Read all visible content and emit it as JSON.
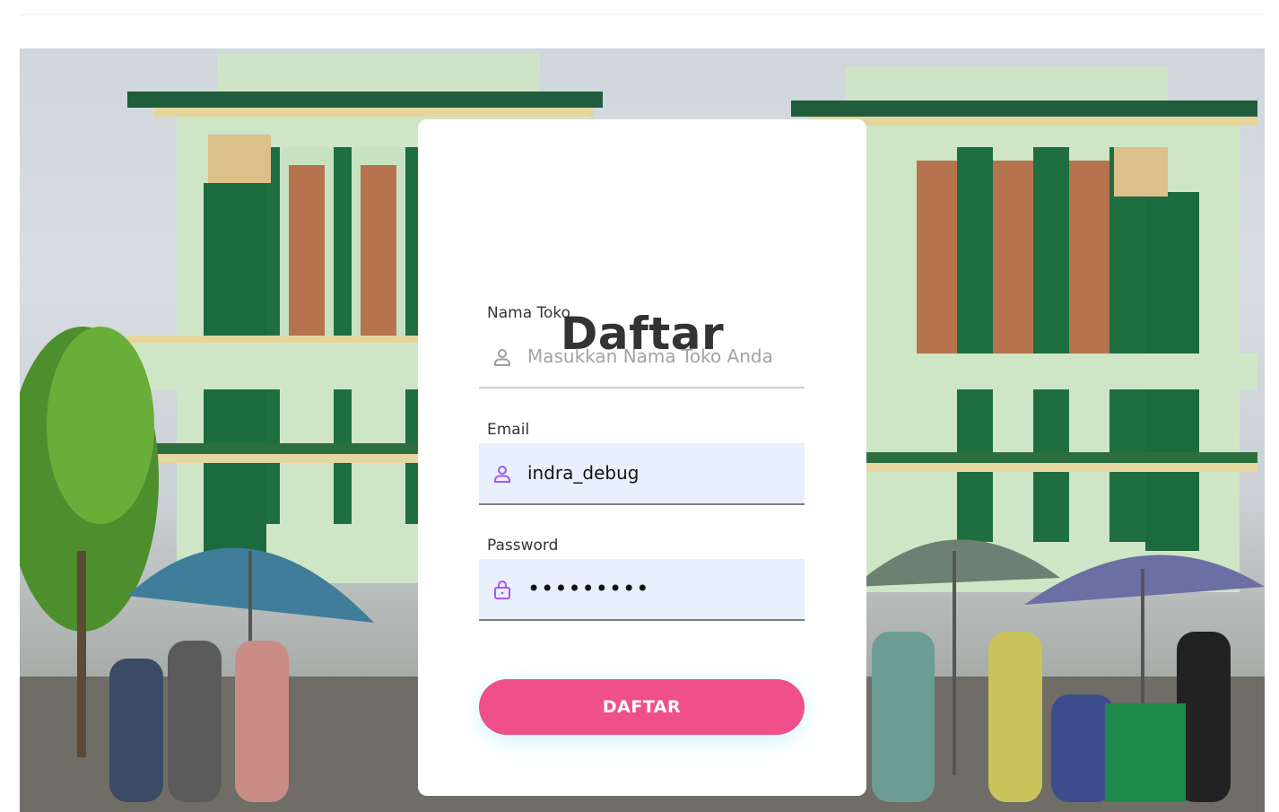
{
  "form": {
    "title": "Daftar",
    "store_name": {
      "label": "Nama Toko",
      "placeholder": "Masukkan Nama Toko Anda",
      "value": "",
      "icon": "user-icon"
    },
    "email": {
      "label": "Email",
      "value": "indra_debug",
      "icon": "user-icon"
    },
    "password": {
      "label": "Password",
      "value": "•••••••••",
      "icon": "lock-icon"
    },
    "submit_label": "DAFTAR"
  },
  "colors": {
    "accent": "#f0508a",
    "icon_active": "#a855f7",
    "icon_idle": "#9e9e9e",
    "autofill_bg": "#e8f0fe",
    "title": "#333333"
  }
}
